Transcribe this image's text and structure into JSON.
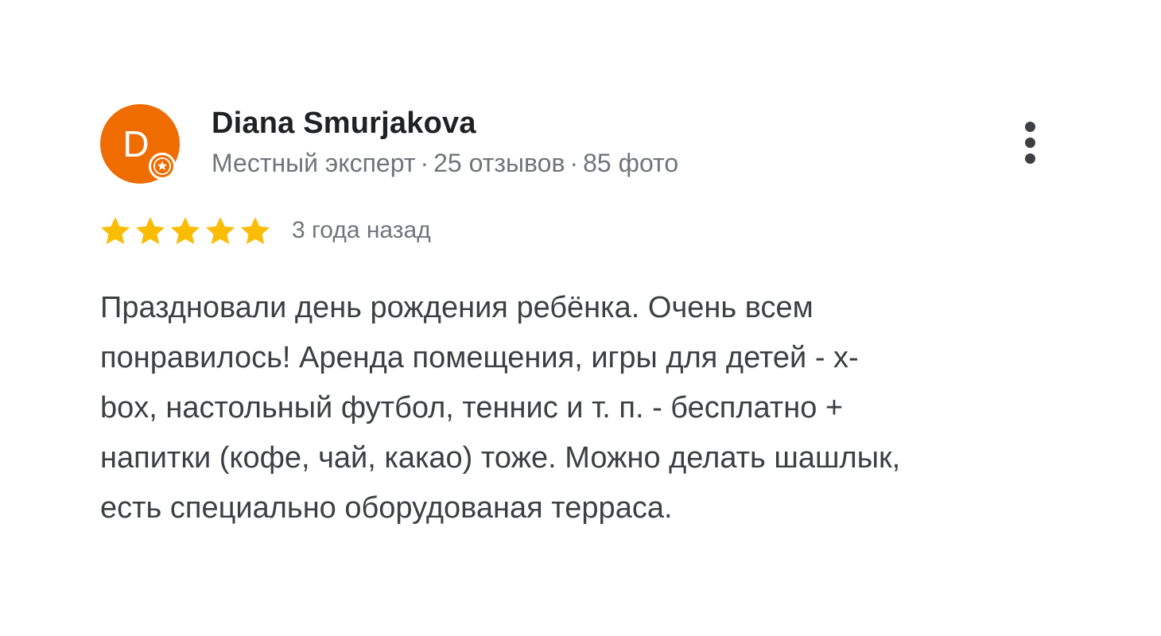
{
  "review": {
    "author": {
      "avatar_initial": "D",
      "avatar_color": "#ef6c00",
      "badge_icon": "local-guide-star-icon",
      "name": "Diana Smurjakova",
      "meta": {
        "status": "Местный эксперт",
        "separator": "·",
        "reviews": "25 отзывов",
        "photos": "85 фото"
      }
    },
    "menu_icon": "more-vert-icon",
    "rating": 5,
    "rating_max": 5,
    "star_color": "#fbbc04",
    "time": "3 года назад",
    "text_lines": [
      "Праздновали день рождения ребёнка. Очень всем",
      "понравилось! Аренда помещения, игры для детей - x-",
      "box, настольный футбол, теннис и т. п. - бесплатно +",
      "напитки (кофе, чай, какао) тоже. Можно делать шашлык,",
      "есть специально оборудованая терраса."
    ]
  }
}
